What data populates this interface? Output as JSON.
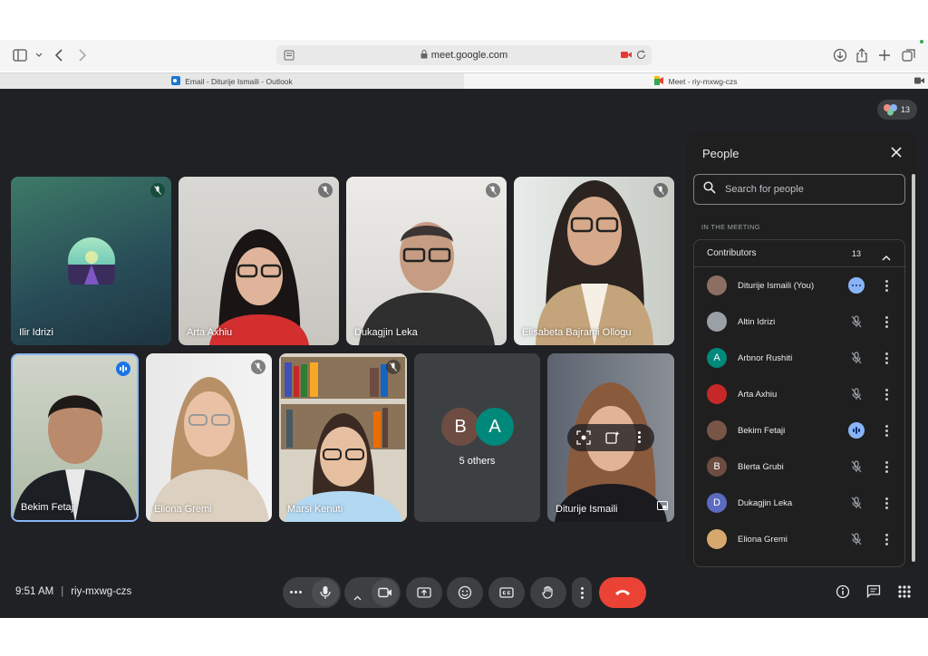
{
  "browser": {
    "url": "meet.google.com",
    "tabs": [
      {
        "label": "Email - Diturije Ismaili - Outlook"
      },
      {
        "label": "Meet - riy-mxwg-czs"
      }
    ]
  },
  "header": {
    "participant_count": "13"
  },
  "tiles": [
    {
      "name": "Ilir Idrizi"
    },
    {
      "name": "Arta Axhiu"
    },
    {
      "name": "Dukagjin Leka"
    },
    {
      "name": "Elisabeta Bajrami Ollogu"
    },
    {
      "name": "Bekim Fetaji"
    },
    {
      "name": "Eliona Gremi"
    },
    {
      "name": "Marsi Kenuti"
    },
    {
      "name": "5 others",
      "initials": [
        "B",
        "A"
      ]
    },
    {
      "name": "Diturije Ismaili"
    }
  ],
  "people_panel": {
    "title": "People",
    "search_placeholder": "Search for people",
    "section_label": "IN THE MEETING",
    "group_title": "Contributors",
    "group_count": "13",
    "participants": [
      {
        "name": "Diturije Ismaili (You)",
        "avatar": "",
        "color": "#8d6e63",
        "status": "more"
      },
      {
        "name": "Altin Idrizi",
        "avatar": "",
        "color": "#9aa0a6",
        "status": "muted"
      },
      {
        "name": "Arbnor Rushiti",
        "avatar": "A",
        "color": "#00897b",
        "status": "muted"
      },
      {
        "name": "Arta Axhiu",
        "avatar": "",
        "color": "#c62828",
        "status": "muted"
      },
      {
        "name": "Bekim Fetaji",
        "avatar": "",
        "color": "#795548",
        "status": "speaking"
      },
      {
        "name": "Blerta Grubi",
        "avatar": "B",
        "color": "#6d4c41",
        "status": "muted"
      },
      {
        "name": "Dukagjin Leka",
        "avatar": "D",
        "color": "#5c6bc0",
        "status": "muted"
      },
      {
        "name": "Eliona Gremi",
        "avatar": "",
        "color": "#d7a86e",
        "status": "muted"
      }
    ]
  },
  "footer": {
    "time": "9:51 AM",
    "meeting_code": "riy-mxwg-czs"
  },
  "colors": {
    "accent": "#8ab4f8",
    "end_call": "#ea4335",
    "background": "#202124"
  }
}
